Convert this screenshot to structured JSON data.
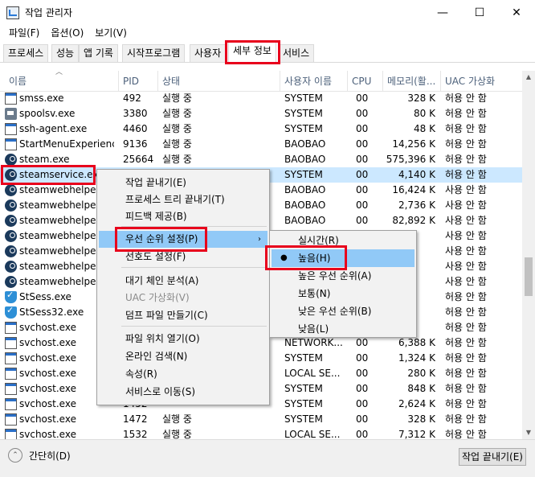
{
  "window": {
    "title": "작업 관리자",
    "minimize": "—",
    "maximize": "☐",
    "close": "✕"
  },
  "menubar": [
    "파일(F)",
    "옵션(O)",
    "보기(V)"
  ],
  "tabs": [
    "프로세스",
    "성능",
    "앱 기록",
    "시작프로그램",
    "사용자",
    "세부 정보",
    "서비스"
  ],
  "active_tab": "세부 정보",
  "columns": [
    "이름",
    "PID",
    "상태",
    "사용자 이름",
    "CPU",
    "메모리(활...",
    "UAC 가상화"
  ],
  "rows": [
    {
      "icon": "exe",
      "name": "smss.exe",
      "pid": "492",
      "status": "실행 중",
      "user": "SYSTEM",
      "cpu": "00",
      "mem": "328 K",
      "uac": "허용 안 함"
    },
    {
      "icon": "printer",
      "name": "spoolsv.exe",
      "pid": "3380",
      "status": "실행 중",
      "user": "SYSTEM",
      "cpu": "00",
      "mem": "80 K",
      "uac": "허용 안 함"
    },
    {
      "icon": "exe",
      "name": "ssh-agent.exe",
      "pid": "4460",
      "status": "실행 중",
      "user": "SYSTEM",
      "cpu": "00",
      "mem": "48 K",
      "uac": "허용 안 함"
    },
    {
      "icon": "exe",
      "name": "StartMenuExperienc...",
      "pid": "9136",
      "status": "실행 중",
      "user": "BAOBAO",
      "cpu": "00",
      "mem": "14,256 K",
      "uac": "허용 안 함"
    },
    {
      "icon": "steam",
      "name": "steam.exe",
      "pid": "25664",
      "status": "실행 중",
      "user": "BAOBAO",
      "cpu": "00",
      "mem": "575,396 K",
      "uac": "허용 안 함"
    },
    {
      "icon": "steam",
      "name": "steamservice.exe",
      "pid": "",
      "status": "",
      "user": "SYSTEM",
      "cpu": "00",
      "mem": "4,140 K",
      "uac": "허용 안 함",
      "selected": true
    },
    {
      "icon": "steam",
      "name": "steamwebhelper.ex...",
      "pid": "",
      "status": "",
      "user": "BAOBAO",
      "cpu": "00",
      "mem": "16,424 K",
      "uac": "사용 안 함"
    },
    {
      "icon": "steam",
      "name": "steamwebhelper.ex...",
      "pid": "",
      "status": "",
      "user": "BAOBAO",
      "cpu": "00",
      "mem": "2,736 K",
      "uac": "사용 안 함"
    },
    {
      "icon": "steam",
      "name": "steamwebhelper.ex...",
      "pid": "",
      "status": "",
      "user": "BAOBAO",
      "cpu": "00",
      "mem": "82,892 K",
      "uac": "사용 안 함"
    },
    {
      "icon": "steam",
      "name": "steamwebhelper.ex...",
      "pid": "",
      "status": "",
      "user": "",
      "cpu": "",
      "mem": "",
      "uac": "사용 안 함"
    },
    {
      "icon": "steam",
      "name": "steamwebhelper.ex...",
      "pid": "",
      "status": "",
      "user": "",
      "cpu": "",
      "mem": "",
      "uac": "사용 안 함"
    },
    {
      "icon": "steam",
      "name": "steamwebhelper.ex...",
      "pid": "",
      "status": "",
      "user": "",
      "cpu": "",
      "mem": "",
      "uac": "사용 안 함"
    },
    {
      "icon": "steam",
      "name": "steamwebhelper.ex...",
      "pid": "",
      "status": "",
      "user": "",
      "cpu": "",
      "mem": "",
      "uac": "사용 안 함"
    },
    {
      "icon": "shield",
      "name": "StSess.exe",
      "pid": "",
      "status": "",
      "user": "",
      "cpu": "",
      "mem": "",
      "uac": "허용 안 함"
    },
    {
      "icon": "shield",
      "name": "StSess32.exe",
      "pid": "",
      "status": "",
      "user": "",
      "cpu": "",
      "mem": "",
      "uac": "허용 안 함"
    },
    {
      "icon": "exe",
      "name": "svchost.exe",
      "pid": "",
      "status": "",
      "user": "",
      "cpu": "",
      "mem": "",
      "uac": "허용 안 함"
    },
    {
      "icon": "exe",
      "name": "svchost.exe",
      "pid": "",
      "status": "",
      "user": "NETWORK...",
      "cpu": "00",
      "mem": "6,388 K",
      "uac": "허용 안 함"
    },
    {
      "icon": "exe",
      "name": "svchost.exe",
      "pid": "",
      "status": "",
      "user": "SYSTEM",
      "cpu": "00",
      "mem": "1,324 K",
      "uac": "허용 안 함"
    },
    {
      "icon": "exe",
      "name": "svchost.exe",
      "pid": "",
      "status": "",
      "user": "LOCAL SE...",
      "cpu": "00",
      "mem": "280 K",
      "uac": "허용 안 함"
    },
    {
      "icon": "exe",
      "name": "svchost.exe",
      "pid": "",
      "status": "",
      "user": "SYSTEM",
      "cpu": "00",
      "mem": "848 K",
      "uac": "허용 안 함"
    },
    {
      "icon": "exe",
      "name": "svchost.exe",
      "pid": "1452",
      "status": "",
      "user": "SYSTEM",
      "cpu": "00",
      "mem": "2,624 K",
      "uac": "허용 안 함"
    },
    {
      "icon": "exe",
      "name": "svchost.exe",
      "pid": "1472",
      "status": "실행 중",
      "user": "SYSTEM",
      "cpu": "00",
      "mem": "328 K",
      "uac": "허용 안 함"
    },
    {
      "icon": "exe",
      "name": "svchost.exe",
      "pid": "1532",
      "status": "실행 중",
      "user": "LOCAL SE...",
      "cpu": "00",
      "mem": "7,312 K",
      "uac": "허용 안 함"
    }
  ],
  "context_menu": [
    {
      "label": "작업 끝내기(E)",
      "disabled": false
    },
    {
      "label": "프로세스 트리 끝내기(T)",
      "disabled": false
    },
    {
      "label": "피드백 제공(B)",
      "disabled": false
    },
    {
      "label": "우선 순위 설정(P)",
      "disabled": false,
      "submenu": true,
      "hover": true
    },
    {
      "label": "선호도 설정(F)",
      "disabled": false
    },
    {
      "label": "대기 체인 분석(A)",
      "disabled": false
    },
    {
      "label": "UAC 가상화(V)",
      "disabled": true
    },
    {
      "label": "덤프 파일 만들기(C)",
      "disabled": false
    },
    {
      "label": "파일 위치 열기(O)",
      "disabled": false
    },
    {
      "label": "온라인 검색(N)",
      "disabled": false
    },
    {
      "label": "속성(R)",
      "disabled": false
    },
    {
      "label": "서비스로 이동(S)",
      "disabled": false
    }
  ],
  "submenu_arrow": "›",
  "priority_submenu": [
    {
      "label": "실시간(R)",
      "checked": false
    },
    {
      "label": "높음(H)",
      "checked": true,
      "hover": true
    },
    {
      "label": "높은 우선 순위(A)",
      "checked": false
    },
    {
      "label": "보통(N)",
      "checked": false
    },
    {
      "label": "낮은 우선 순위(B)",
      "checked": false
    },
    {
      "label": "낮음(L)",
      "checked": false
    }
  ],
  "bullet": "●",
  "footer": {
    "fewer_details_label": "간단히(D)",
    "fewer_details_icon": "⌃",
    "end_task_label": "작업 끝내기(E)"
  },
  "highlight_color": "#e8001c",
  "selected_row_color": "#cce8ff",
  "menu_hover_color": "#91c9f7"
}
